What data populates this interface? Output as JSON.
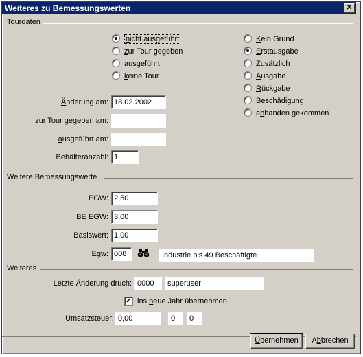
{
  "window": {
    "title": "Weiteres zu Bemessungswerten",
    "close_glyph": "✕"
  },
  "tourdaten": {
    "heading": "Tourdaten",
    "status_options": [
      {
        "pre": "",
        "key": "n",
        "post": "icht ausgeführt",
        "selected": true
      },
      {
        "pre": "",
        "key": "z",
        "post": "ur Tour gegeben",
        "selected": false
      },
      {
        "pre": "",
        "key": "a",
        "post": "usgeführt",
        "selected": false
      },
      {
        "pre": "",
        "key": "k",
        "post": "eine Tour",
        "selected": false
      }
    ],
    "reason_options": [
      {
        "pre": "",
        "key": "K",
        "post": "ein Grund",
        "selected": false
      },
      {
        "pre": "",
        "key": "E",
        "post": "rstausgabe",
        "selected": true
      },
      {
        "pre": "",
        "key": "Z",
        "post": "usätzlich",
        "selected": false
      },
      {
        "pre": "",
        "key": "A",
        "post": "usgabe",
        "selected": false
      },
      {
        "pre": "",
        "key": "R",
        "post": "ückgabe",
        "selected": false
      },
      {
        "pre": "",
        "key": "B",
        "post": "eschädigung",
        "selected": false
      },
      {
        "pre": "a",
        "key": "b",
        "post": "handen gekommen",
        "selected": false
      }
    ],
    "aenderung_label": {
      "pre": "",
      "key": "Ä",
      "post": "nderung am:"
    },
    "aenderung_value": "18.02.2002",
    "tour_label": {
      "pre": "zur ",
      "key": "T",
      "post": "our gegeben am:"
    },
    "tour_value": "",
    "ausgefuehrt_label": {
      "pre": "",
      "key": "a",
      "post": "usgeführt am:"
    },
    "ausgefuehrt_value": "",
    "behaelter_label": "Behälteranzahl:",
    "behaelter_value": "1"
  },
  "bemessung": {
    "heading": "Weitere Bemessungswerte",
    "egw1_label": "EGW:",
    "egw1_value": "2,50",
    "be_egw_label": "BE EGW:",
    "be_egw_value": "3,00",
    "basis_label": "Basiswert:",
    "basis_value": "1,00",
    "egw2_label": {
      "pre": "",
      "key": "E",
      "post": "gw:"
    },
    "egw2_code": "008",
    "egw2_lookup_icon": "binoculars-icon",
    "egw2_desc": "Industrie bis 49 Beschäftigte"
  },
  "weiteres": {
    "heading": "Weiteres",
    "letzte_label": "Letzte Änderung druch:",
    "letzte_code": "0000",
    "letzte_user": "superuser",
    "jahr_checkbox": {
      "pre": "ins ",
      "key": "n",
      "post": "eue Jahr übernehmen",
      "checked": true,
      "mark": "✓"
    },
    "ust_label": "Umsatzsteuer:",
    "ust_value": "0,00",
    "ust_a": "0",
    "ust_b": "0"
  },
  "buttons": {
    "uebernehmen": {
      "pre": "",
      "key": "Ü",
      "post": "bernehmen"
    },
    "abbrechen": {
      "pre": "A",
      "key": "b",
      "post": "brechen"
    }
  }
}
